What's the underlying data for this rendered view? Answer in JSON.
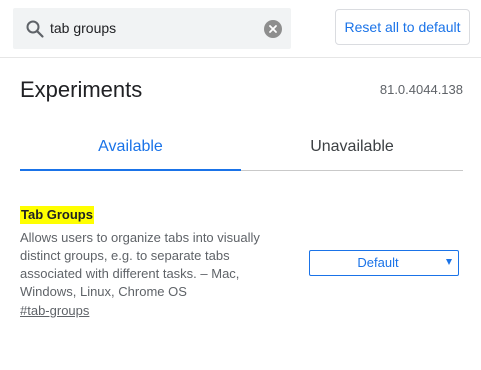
{
  "search": {
    "value": "tab groups",
    "icon": "search-icon",
    "clear_icon": "close-icon"
  },
  "toolbar": {
    "reset_label": "Reset all to default"
  },
  "page": {
    "title": "Experiments",
    "version": "81.0.4044.138"
  },
  "tabs": [
    {
      "label": "Available",
      "active": true
    },
    {
      "label": "Unavailable",
      "active": false
    }
  ],
  "experiment": {
    "title": "Tab Groups",
    "description": "Allows users to organize tabs into visually distinct groups, e.g. to separate tabs associated with different tasks. – Mac, Windows, Linux, Chrome OS",
    "link": "#tab-groups",
    "select_value": "Default"
  },
  "colors": {
    "accent": "#1a73e8",
    "highlight": "#ffff00"
  }
}
